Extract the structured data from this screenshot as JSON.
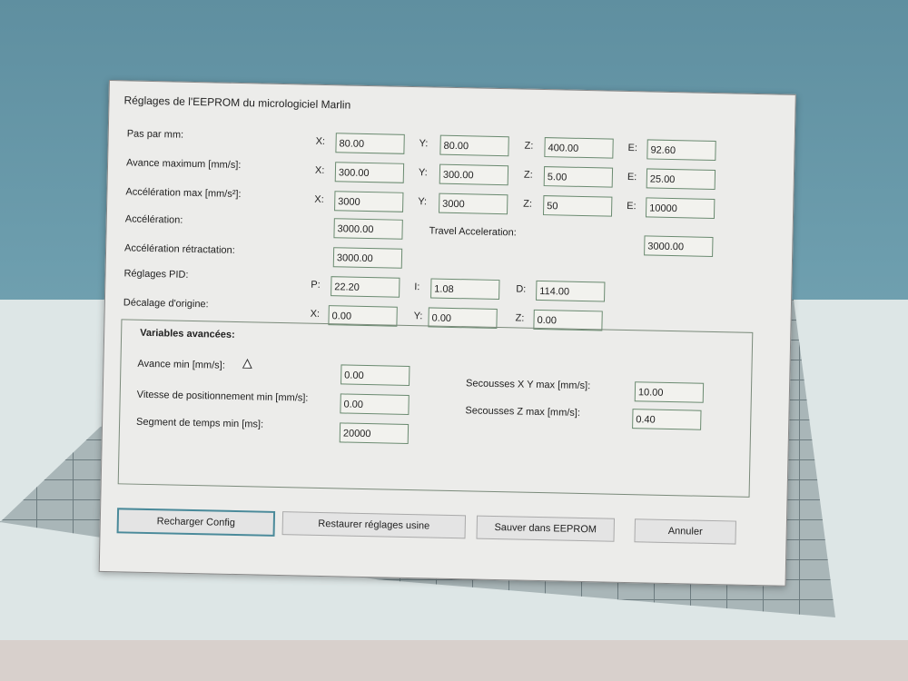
{
  "dialog": {
    "title": "Réglages de l'EEPROM du micrologiciel Marlin",
    "rows": [
      {
        "label": "Pas par mm:",
        "fields": [
          {
            "axis": "X:",
            "value": "80.00"
          },
          {
            "axis": "Y:",
            "value": "80.00"
          },
          {
            "axis": "Z:",
            "value": "400.00"
          },
          {
            "axis": "E:",
            "value": "92.60"
          }
        ]
      },
      {
        "label": "Avance maximum [mm/s]:",
        "fields": [
          {
            "axis": "X:",
            "value": "300.00"
          },
          {
            "axis": "Y:",
            "value": "300.00"
          },
          {
            "axis": "Z:",
            "value": "5.00"
          },
          {
            "axis": "E:",
            "value": "25.00"
          }
        ]
      },
      {
        "label": "Accélération max [mm/s²]:",
        "fields": [
          {
            "axis": "X:",
            "value": "3000"
          },
          {
            "axis": "Y:",
            "value": "3000"
          },
          {
            "axis": "Z:",
            "value": "50"
          },
          {
            "axis": "E:",
            "value": "10000"
          }
        ]
      }
    ],
    "acceleration": {
      "label": "Accélération:",
      "value": "3000.00"
    },
    "travel_acceleration": {
      "label": "Travel Acceleration:",
      "value": "3000.00"
    },
    "retract_acceleration": {
      "label": "Accélération rétractation:",
      "value": "3000.00"
    },
    "pid": {
      "label": "Réglages PID:",
      "p_label": "P:",
      "p": "22.20",
      "i_label": "I:",
      "i": "1.08",
      "d_label": "D:",
      "d": "114.00"
    },
    "offset": {
      "label": "Décalage d'origine:",
      "x_label": "X:",
      "x": "0.00",
      "y_label": "Y:",
      "y": "0.00",
      "z_label": "Z:",
      "z": "0.00"
    },
    "advanced": {
      "title": "Variables avancées:",
      "min_feedrate": {
        "label": "Avance min [mm/s]:",
        "value": "0.00"
      },
      "min_travel": {
        "label": "Vitesse de positionnement min [mm/s]:",
        "value": "0.00"
      },
      "min_segment": {
        "label": "Segment de temps min [ms]:",
        "value": "20000"
      },
      "jerk_xy": {
        "label": "Secousses X Y max [mm/s]:",
        "value": "10.00"
      },
      "jerk_z": {
        "label": "Secousses Z max [mm/s]:",
        "value": "0.40"
      }
    },
    "buttons": {
      "reload": "Recharger Config",
      "restore": "Restaurer réglages usine",
      "save": "Sauver dans EEPROM",
      "cancel": "Annuler"
    }
  }
}
